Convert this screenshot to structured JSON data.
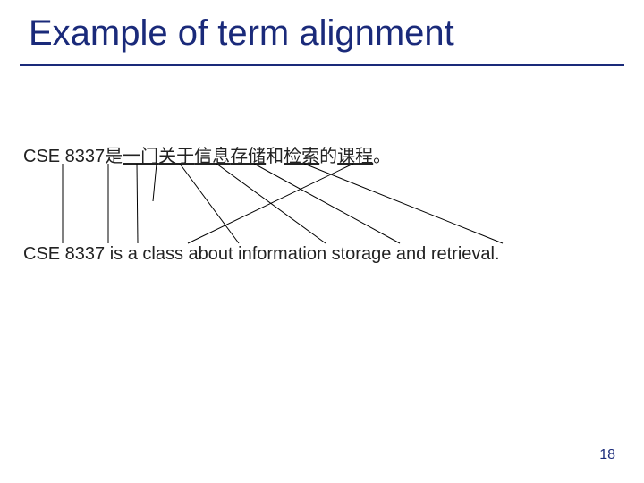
{
  "slide": {
    "title": "Example of term alignment",
    "page_number": "18"
  },
  "source": {
    "tokens": {
      "cse": "CSE 8337",
      "shi": "是",
      "yimen": "一门",
      "guanyu": "关于",
      "xinxi": "信息",
      "cunchu": "存储",
      "he": "和",
      "jiansuo": "检索",
      "de": "的",
      "kecheng": "课程",
      "period": "。"
    }
  },
  "target": {
    "sentence": "CSE 8337 is a class about information storage and retrieval."
  }
}
